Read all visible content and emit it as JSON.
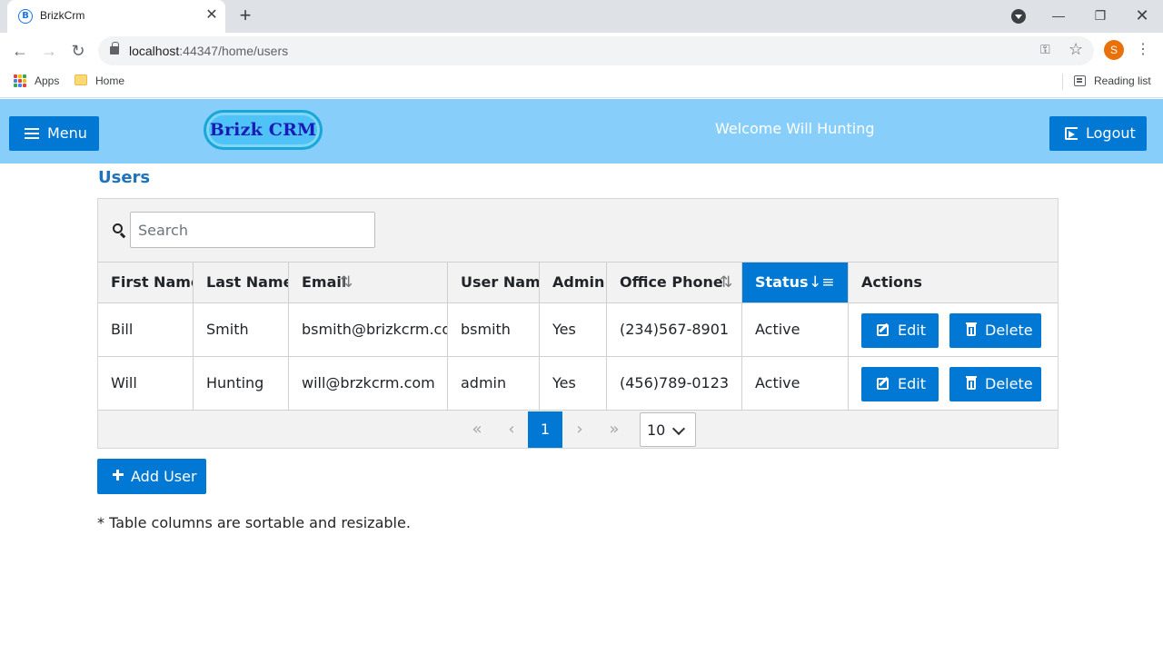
{
  "browser": {
    "tab_title": "BrizkCrm",
    "favicon_letter": "B",
    "url_host": "localhost",
    "url_path": ":44347/home/users",
    "profile_initial": "S",
    "bookmarks": {
      "apps": "Apps",
      "home": "Home",
      "reading_list": "Reading list"
    }
  },
  "header": {
    "menu_label": "Menu",
    "logo_text": "Brizk CRM",
    "welcome": "Welcome Will Hunting",
    "logout_label": "Logout",
    "bg_color": "#87cefa",
    "accent": "#0078d4"
  },
  "page": {
    "title": "Users",
    "search_placeholder": "Search",
    "columns": [
      {
        "label": "First Name",
        "sortable": false
      },
      {
        "label": "Last Name",
        "sortable": false
      },
      {
        "label": "Email",
        "sortable": true,
        "sort_icon": "sort-both-icon"
      },
      {
        "label": "User Name",
        "sortable": false
      },
      {
        "label": "Admin",
        "sortable": false
      },
      {
        "label": "Office Phone",
        "sortable": true,
        "sort_icon": "sort-both-icon"
      },
      {
        "label": "Status",
        "sortable": true,
        "sort_icon": "sort-desc-icon",
        "active": true
      },
      {
        "label": "Actions",
        "sortable": false
      }
    ],
    "rows": [
      {
        "first_name": "Bill",
        "last_name": "Smith",
        "email": "bsmith@brizkcrm.com",
        "username": "bsmith",
        "admin": "Yes",
        "phone": "(234)567-8901",
        "status": "Active"
      },
      {
        "first_name": "Will",
        "last_name": "Hunting",
        "email": "will@brzkcrm.com",
        "username": "admin",
        "admin": "Yes",
        "phone": "(456)789-0123",
        "status": "Active"
      }
    ],
    "row_actions": {
      "edit": "Edit",
      "delete": "Delete"
    },
    "pager": {
      "first": "«",
      "prev": "‹",
      "current_page": "1",
      "next": "›",
      "last": "»",
      "page_size": "10"
    },
    "add_user_label": "Add User",
    "footnote": "* Table columns are sortable and resizable."
  }
}
